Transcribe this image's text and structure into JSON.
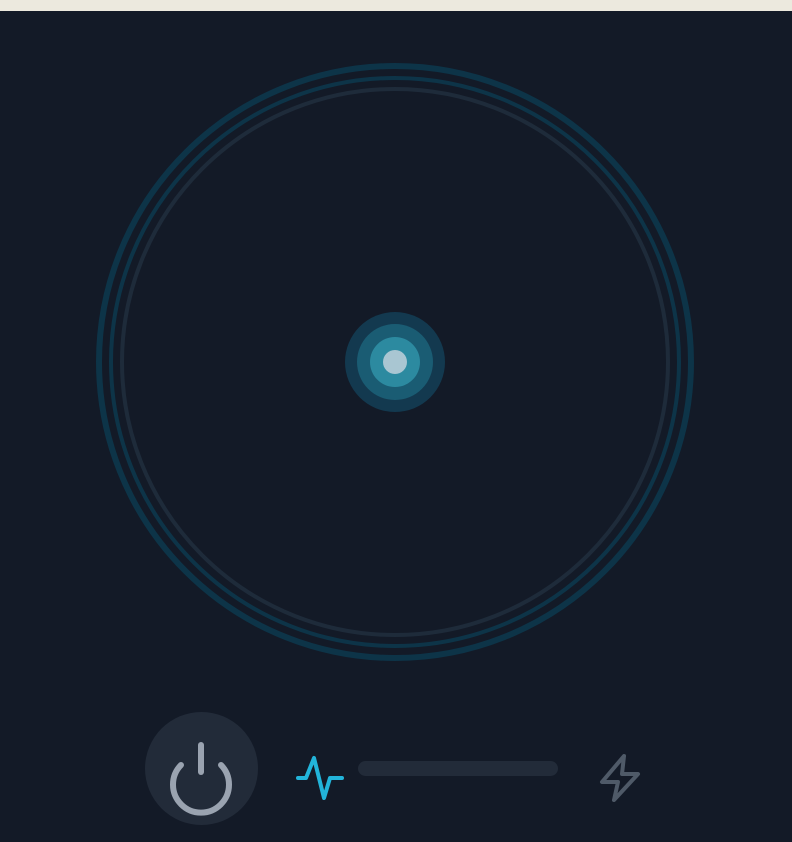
{
  "colors": {
    "frame": "#ECE9DE",
    "background": "#131A27",
    "ring_outer": "#0D3448",
    "ring_inner": "#1E2B3A",
    "core_glow": "#13394F",
    "core_mid": "#1A5C73",
    "core_ring": "#2C8AA0",
    "core_dot": "#A9C6D2",
    "accent": "#22B4DA",
    "control_bg": "#222B39",
    "power_glyph": "#9AA3B0",
    "bolt_glyph": "#4F5A68"
  },
  "icons": {
    "power": "power-icon",
    "activity": "pulse-icon",
    "energy": "lightning-bolt-icon"
  },
  "controls": {
    "level": 0
  }
}
